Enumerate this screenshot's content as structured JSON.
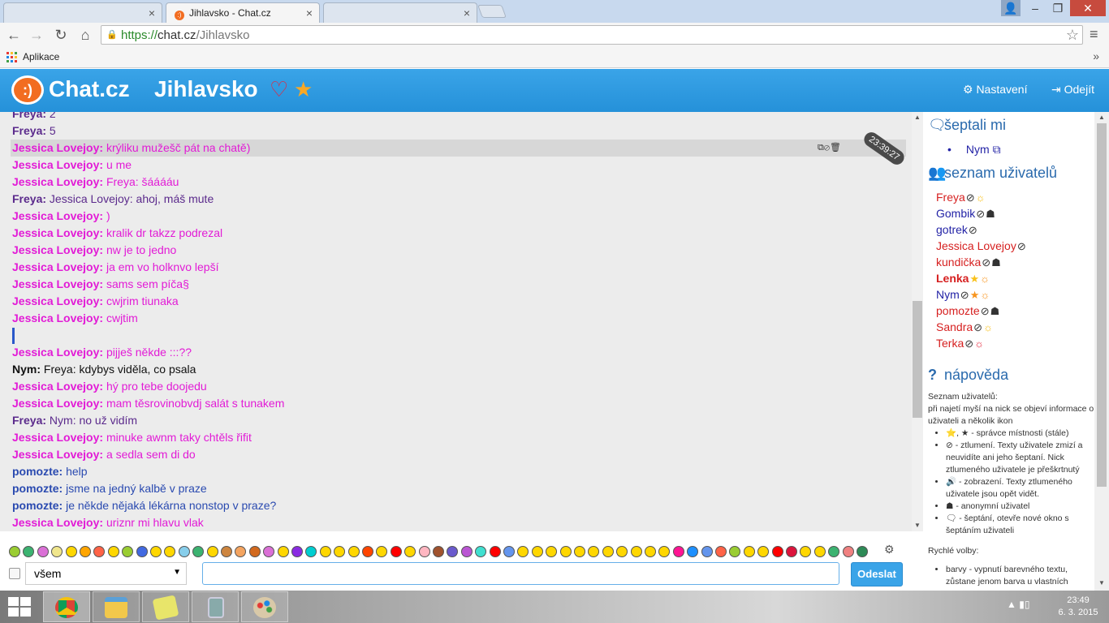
{
  "browser": {
    "tabs": [
      {
        "label": "",
        "active": false
      },
      {
        "label": "Jihlavsko - Chat.cz",
        "active": true
      },
      {
        "label": "",
        "active": false
      }
    ],
    "close_glyph": "×",
    "url": {
      "scheme": "https://",
      "host": "chat.cz",
      "path": "/Jihlavsko"
    },
    "bookmarks_label": "Aplikace",
    "bookmarks_more": "»"
  },
  "header": {
    "logo_glyph": ":)",
    "brand": "Chat.cz",
    "room": "Jihlavsko",
    "heart_glyph": "♡",
    "star_glyph": "★",
    "settings_label": "⚙ Nastavení",
    "leave_label": "⇥ Odejít"
  },
  "chat": {
    "highlight_timestamp": "23:39:27",
    "messages": [
      {
        "nick": "Freya:",
        "text": " 2",
        "color": "#5b2a8c"
      },
      {
        "nick": "Freya:",
        "text": " 5",
        "color": "#5b2a8c"
      },
      {
        "nick": "Jessica Lovejoy:",
        "text": " krýliku mužešč pát na chatě)",
        "color": "#e21bd6",
        "highlight": true
      },
      {
        "nick": "Jessica Lovejoy:",
        "text": " u me",
        "color": "#e21bd6"
      },
      {
        "nick": "Jessica Lovejoy:",
        "text": " Freya: šááááu",
        "color": "#e21bd6"
      },
      {
        "nick": "Freya:",
        "text": " Jessica Lovejoy: ahoj, máš mute",
        "color": "#5b2a8c"
      },
      {
        "nick": "Jessica Lovejoy:",
        "text": " )",
        "color": "#e21bd6"
      },
      {
        "nick": "Jessica Lovejoy:",
        "text": " kralik dr takzz podrezal",
        "color": "#e21bd6"
      },
      {
        "nick": "Jessica Lovejoy:",
        "text": " nw je to jedno",
        "color": "#e21bd6"
      },
      {
        "nick": "Jessica Lovejoy:",
        "text": " ja em vo holknvo lepší",
        "color": "#e21bd6"
      },
      {
        "nick": "Jessica Lovejoy:",
        "text": " sams sem píča§",
        "color": "#e21bd6"
      },
      {
        "nick": "Jessica Lovejoy:",
        "text": " cwjrim tiunaka",
        "color": "#e21bd6"
      },
      {
        "nick": "Jessica Lovejoy:",
        "text": " cwjtim",
        "color": "#e21bd6"
      },
      {
        "nick": "",
        "text": "",
        "color": "#2a58c9",
        "cursor": true
      },
      {
        "nick": "Jessica Lovejoy:",
        "text": " pijješ někde :::??",
        "color": "#e21bd6"
      },
      {
        "nick": "Nym:",
        "text": " Freya: kdybys viděla, co psala",
        "color": "#111111"
      },
      {
        "nick": "Jessica Lovejoy:",
        "text": " hý pro tebe doojedu",
        "color": "#e21bd6"
      },
      {
        "nick": "Jessica Lovejoy:",
        "text": " mam těsrovinobvdj salát s tunakem",
        "color": "#e21bd6"
      },
      {
        "nick": "Freya:",
        "text": " Nym: no už vidím",
        "color": "#5b2a8c"
      },
      {
        "nick": "Jessica Lovejoy:",
        "text": " minuke awnm taky chtěls řifit",
        "color": "#e21bd6"
      },
      {
        "nick": "Jessica Lovejoy:",
        "text": " a sedla sem di do",
        "color": "#e21bd6"
      },
      {
        "nick": "pomozte:",
        "text": " help",
        "color": "#2a4ab0"
      },
      {
        "nick": "pomozte:",
        "text": " jsme na jedný kalbě v praze",
        "color": "#2a4ab0"
      },
      {
        "nick": "pomozte:",
        "text": " je někde nějaká lékárna nonstop v praze?",
        "color": "#2a4ab0"
      },
      {
        "nick": "Jessica Lovejoy:",
        "text": " uriznr mi hlavu vlak",
        "color": "#e21bd6"
      }
    ],
    "message_icons": "⧉⊘🗑"
  },
  "sidebar": {
    "whisper_title": "šeptali mi",
    "whisper_icon": "🗨",
    "whisper_users": [
      "Nym ⧉"
    ],
    "users_title": "seznam uživatelů",
    "users_icon": "👥",
    "users": [
      {
        "name": "Freya",
        "color": "#d62020",
        "bold": false,
        "icons": [
          {
            "g": "⊘",
            "c": ""
          },
          {
            "g": "☼",
            "c": "gold"
          }
        ]
      },
      {
        "name": "Gombik",
        "color": "#2323a6",
        "bold": false,
        "icons": [
          {
            "g": "⊘",
            "c": ""
          },
          {
            "g": "☗",
            "c": ""
          }
        ]
      },
      {
        "name": "gotrek",
        "color": "#2323a6",
        "bold": false,
        "icons": [
          {
            "g": "⊘",
            "c": ""
          }
        ]
      },
      {
        "name": "Jessica Lovejoy",
        "color": "#d62020",
        "bold": false,
        "icons": [
          {
            "g": "⊘",
            "c": ""
          }
        ]
      },
      {
        "name": "kundička",
        "color": "#d62020",
        "bold": false,
        "icons": [
          {
            "g": "⊘",
            "c": ""
          },
          {
            "g": "☗",
            "c": ""
          }
        ]
      },
      {
        "name": "Lenka",
        "color": "#d62020",
        "bold": true,
        "icons": [
          {
            "g": "★",
            "c": "gold"
          },
          {
            "g": "☼",
            "c": "orange"
          }
        ]
      },
      {
        "name": "Nym",
        "color": "#2323a6",
        "bold": false,
        "icons": [
          {
            "g": "⊘",
            "c": ""
          },
          {
            "g": "★",
            "c": "orange"
          },
          {
            "g": "☼",
            "c": "orange"
          }
        ]
      },
      {
        "name": "pomozte",
        "color": "#d62020",
        "bold": false,
        "icons": [
          {
            "g": "⊘",
            "c": ""
          },
          {
            "g": "☗",
            "c": ""
          }
        ]
      },
      {
        "name": "Sandra",
        "color": "#d62020",
        "bold": false,
        "icons": [
          {
            "g": "⊘",
            "c": ""
          },
          {
            "g": "☼",
            "c": "gold"
          }
        ]
      },
      {
        "name": "Terka",
        "color": "#d62020",
        "bold": false,
        "icons": [
          {
            "g": "⊘",
            "c": ""
          },
          {
            "g": "☼",
            "c": "red"
          }
        ]
      }
    ],
    "help_title": "nápověda",
    "help_icon": "?",
    "help_intro_1": "Seznam uživatelů:",
    "help_intro_2": "při najetí myší na nick se objeví informace o uživateli a několik ikon",
    "help_items": [
      "⭐, ★ - správce místnosti (stále)",
      "⊘ - ztlumení. Texty uživatele zmizí a neuvidíte ani jeho šeptaní. Nick ztlumeného uživatele je přeškrtnutý",
      "🔊 - zobrazení. Texty ztlumeného uživatele jsou opět vidět.",
      "☗ - anonymní uživatel",
      "🗨 - šeptání, otevře nové okno s šeptáním uživateli"
    ],
    "quick_title": "Rychlé volby:",
    "quick_items": [
      "barvy - vypnutí barevného textu, zůstane jenom barva u vlastních"
    ]
  },
  "input": {
    "target_value": "všem",
    "message_value": "",
    "send_label": "Odeslat",
    "gear_glyph": "⚙"
  },
  "taskbar": {
    "time": "23:49",
    "date": "6. 3. 2015",
    "tray": "▲ ▮▯"
  },
  "colors": {
    "header_blue": "#2591d9",
    "accent_orange": "#f26d21"
  }
}
